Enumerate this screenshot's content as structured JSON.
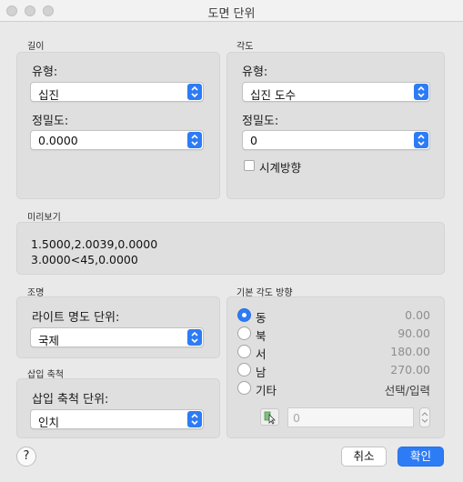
{
  "window": {
    "title": "도면 단위"
  },
  "length": {
    "group_label": "길이",
    "type_label": "유형:",
    "type_value": "십진",
    "precision_label": "정밀도:",
    "precision_value": "0.0000"
  },
  "angle": {
    "group_label": "각도",
    "type_label": "유형:",
    "type_value": "십진 도수",
    "precision_label": "정밀도:",
    "precision_value": "0",
    "clockwise_label": "시계방향",
    "clockwise_checked": false
  },
  "preview": {
    "group_label": "미리보기",
    "line1": "1.5000,2.0039,0.0000",
    "line2": "3.0000<45,0.0000"
  },
  "lighting": {
    "group_label": "조명",
    "units_label": "라이트 명도 단위:",
    "units_value": "국제"
  },
  "insertion": {
    "group_label": "삽입 축척",
    "units_label": "삽입 축척 단위:",
    "units_value": "인치"
  },
  "base_angle": {
    "group_label": "기본 각도 방향",
    "options": [
      {
        "label": "동",
        "value": "0.00",
        "selected": true
      },
      {
        "label": "북",
        "value": "90.00",
        "selected": false
      },
      {
        "label": "서",
        "value": "180.00",
        "selected": false
      },
      {
        "label": "남",
        "value": "270.00",
        "selected": false
      },
      {
        "label": "기타",
        "value": "선택/입력",
        "selected": false
      }
    ],
    "other_angle_value": "0"
  },
  "footer": {
    "help_label": "?",
    "cancel_label": "취소",
    "ok_label": "확인"
  },
  "colors": {
    "accent": "#2d7cf6",
    "panel": "#dfdfdf",
    "background": "#e9e9e9"
  },
  "icons": [
    "close-light",
    "minimize-light",
    "zoom-light",
    "chevron-updown-icon",
    "checkbox",
    "radio",
    "pick-point-icon",
    "stepper-icon",
    "help-icon"
  ]
}
